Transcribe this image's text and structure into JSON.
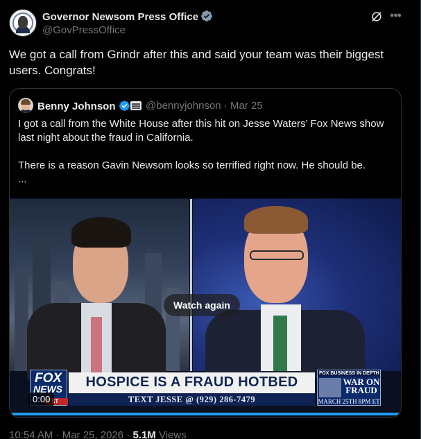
{
  "author": {
    "name": "Governor Newsom Press Office",
    "handle": "@GovPressOffice",
    "verified": true
  },
  "tweet": {
    "text": "We got a call from Grindr after this and said your team was their biggest users. Congrats!"
  },
  "quote": {
    "name": "Benny Johnson",
    "handle_date": "@bennyjohnson · Mar 25",
    "paragraph1": "I got a call from the White House after this hit on Jesse Waters’ Fox News show last night about the fraud in California.",
    "paragraph2": "There is a reason Gavin Newsom looks so terrified right now. He should be.",
    "ellipsis": "..."
  },
  "video": {
    "watch_again_label": "Watch again",
    "timecode": "0:00",
    "progress": 1.0,
    "chyron": {
      "logo_line1": "FOX",
      "logo_line2": "NEWS",
      "logo_line3": "B ET",
      "headline": "HOSPICE IS A FRAUD HOTBED",
      "subline": "TEXT JESSE @ (929) 286-7479",
      "promo_top": "FOX BUSINESS IN DEPTH",
      "promo_title_line1": "WAR ON",
      "promo_title_line2": "FRAUD",
      "promo_date": "MARCH 25TH 8PM ET"
    }
  },
  "meta": {
    "time_date": "10:54 AM · Mar 25, 2026 · ",
    "views_count": "5.1M",
    "views_label": " Views"
  },
  "colors": {
    "accent": "#1d9bf0",
    "text": "#e7e9ea",
    "muted": "#71767b",
    "border": "#2f3336"
  },
  "icons": [
    "verified-badge-icon",
    "grok-icon",
    "more-icon",
    "flag-icon"
  ]
}
